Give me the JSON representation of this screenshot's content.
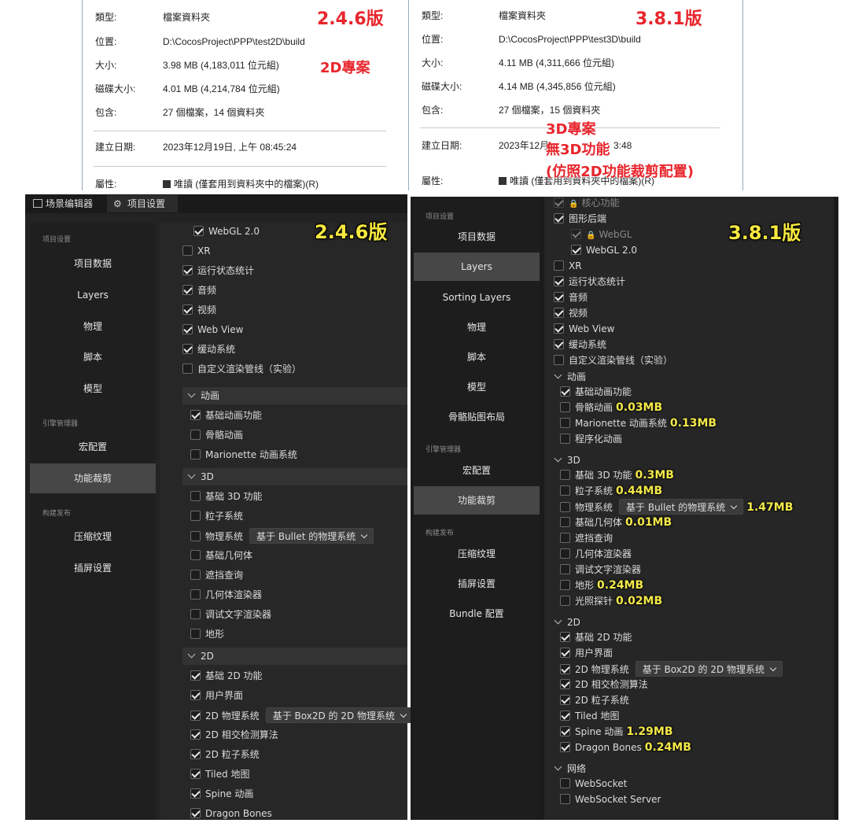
{
  "win_left": {
    "type_k": "類型:",
    "type_v": "檔案資料夾",
    "loc_k": "位置:",
    "loc_v": "D:\\CocosProject\\PPP\\test2D\\build",
    "size_k": "大小:",
    "size_v": "3.98 MB (4,183,011 位元組)",
    "disk_k": "磁碟大小:",
    "disk_v": "4.01 MB (4,214,784 位元組)",
    "contains_k": "包含:",
    "contains_v": "27 個檔案，14 個資料夾",
    "created_k": "建立日期:",
    "created_v": "2023年12月19日, 上午 08:45:24",
    "attr_k": "屬性:",
    "attr_v": "唯讀 (僅套用到資料夾中的檔案)(R)",
    "ver": "2.4.6版",
    "note": "2D專案"
  },
  "win_right": {
    "type_k": "類型:",
    "type_v": "檔案資料夾",
    "loc_k": "位置:",
    "loc_v": "D:\\CocosProject\\PPP\\test3D\\build",
    "size_k": "大小:",
    "size_v": "4.11 MB (4,311,666 位元組)",
    "disk_k": "磁碟大小:",
    "disk_v": "4.14 MB (4,345,856 位元組)",
    "contains_k": "包含:",
    "contains_v": "27 個檔案，15 個資料夾",
    "created_k": "建立日期:",
    "created_v_a": "2023年12月",
    "created_v_b": "3:48",
    "attr_k": "屬性:",
    "attr_v": "唯讀 (僅套用到資料夾中的檔案)(R)",
    "ver": "3.8.1版",
    "note1": "3D專案",
    "note2": "無3D功能",
    "note3": "(仿照2D功能裁剪配置)"
  },
  "left_panel": {
    "tab1": "场景编辑器",
    "tab2": "项目设置",
    "sec1": "项目设置",
    "sec2": "引擎管理器",
    "sec3": "构建发布",
    "nav": [
      "项目数据",
      "Layers",
      "物理",
      "脚本",
      "模型",
      "宏配置",
      "功能裁剪",
      "压缩纹理",
      "插屏设置"
    ],
    "ver": "2.4.6版",
    "items_top": [
      {
        "label": "WebGL 2.0",
        "on": true
      },
      {
        "label": "XR",
        "on": false
      },
      {
        "label": "运行状态统计",
        "on": true
      },
      {
        "label": "音频",
        "on": true
      },
      {
        "label": "视频",
        "on": true
      },
      {
        "label": "Web View",
        "on": true
      },
      {
        "label": "缓动系统",
        "on": true
      },
      {
        "label": "自定义渲染管线（实验）",
        "on": false
      }
    ],
    "grp_anim": "动画",
    "anim": [
      {
        "label": "基础动画功能",
        "on": true
      },
      {
        "label": "骨骼动画",
        "on": false
      },
      {
        "label": "Marionette 动画系统",
        "on": false
      }
    ],
    "grp_3d": "3D",
    "d3": [
      {
        "label": "基础 3D 功能",
        "on": false
      },
      {
        "label": "粒子系统",
        "on": false
      },
      {
        "label": "物理系统",
        "on": false
      },
      {
        "label": "基础几何体",
        "on": false
      },
      {
        "label": "遮挡查询",
        "on": false
      },
      {
        "label": "几何体渲染器",
        "on": false
      },
      {
        "label": "调试文字渲染器",
        "on": false
      },
      {
        "label": "地形",
        "on": false
      }
    ],
    "physics_sel": "基于 Bullet 的物理系统",
    "grp_2d": "2D",
    "d2": [
      {
        "label": "基础 2D 功能",
        "on": true
      },
      {
        "label": "用户界面",
        "on": true
      },
      {
        "label": "2D 物理系统",
        "on": true
      },
      {
        "label": "2D 相交检测算法",
        "on": true
      },
      {
        "label": "2D 粒子系统",
        "on": true
      },
      {
        "label": "Tiled 地图",
        "on": true
      },
      {
        "label": "Spine 动画",
        "on": true
      },
      {
        "label": "Dragon Bones",
        "on": true
      }
    ],
    "physics2d_sel": "基于 Box2D 的 2D 物理系统"
  },
  "right_panel": {
    "sec1": "项目设置",
    "sec2": "引擎管理器",
    "sec3": "构建发布",
    "nav": [
      "项目数据",
      "Layers",
      "Sorting Layers",
      "物理",
      "脚本",
      "模型",
      "骨骼贴图布局",
      "宏配置",
      "功能裁剪",
      "压缩纹理",
      "插屏设置",
      "Bundle 配置"
    ],
    "ver": "3.8.1版",
    "core": "核心功能",
    "gfx": "图形后端",
    "webgl": "WebGL",
    "webgl2": "WebGL 2.0",
    "items_top": [
      {
        "label": "XR",
        "on": false
      },
      {
        "label": "运行状态统计",
        "on": true
      },
      {
        "label": "音频",
        "on": true
      },
      {
        "label": "视频",
        "on": true
      },
      {
        "label": "Web View",
        "on": true
      },
      {
        "label": "缓动系统",
        "on": true
      },
      {
        "label": "自定义渲染管线（实验）",
        "on": false
      }
    ],
    "grp_anim": "动画",
    "anim": [
      {
        "label": "基础动画功能",
        "on": true,
        "size": ""
      },
      {
        "label": "骨骼动画",
        "on": false,
        "size": "0.03MB"
      },
      {
        "label": "Marionette 动画系统",
        "on": false,
        "size": "0.13MB"
      },
      {
        "label": "程序化动画",
        "on": false,
        "size": ""
      }
    ],
    "grp_3d": "3D",
    "d3": [
      {
        "label": "基础 3D 功能",
        "on": false,
        "size": "0.3MB"
      },
      {
        "label": "粒子系统",
        "on": false,
        "size": "0.44MB"
      },
      {
        "label": "物理系统",
        "on": false,
        "size": "1.47MB"
      },
      {
        "label": "基础几何体",
        "on": false,
        "size": "0.01MB"
      },
      {
        "label": "遮挡查询",
        "on": false,
        "size": ""
      },
      {
        "label": "几何体渲染器",
        "on": false,
        "size": ""
      },
      {
        "label": "调试文字渲染器",
        "on": false,
        "size": ""
      },
      {
        "label": "地形",
        "on": false,
        "size": "0.24MB"
      },
      {
        "label": "光照探针",
        "on": false,
        "size": "0.02MB"
      }
    ],
    "physics_sel": "基于 Bullet 的物理系统",
    "grp_2d": "2D",
    "d2": [
      {
        "label": "基础 2D 功能",
        "on": true,
        "size": ""
      },
      {
        "label": "用户界面",
        "on": true,
        "size": ""
      },
      {
        "label": "2D 物理系统",
        "on": true,
        "size": ""
      },
      {
        "label": "2D 相交检测算法",
        "on": true,
        "size": ""
      },
      {
        "label": "2D 粒子系统",
        "on": true,
        "size": ""
      },
      {
        "label": "Tiled 地图",
        "on": true,
        "size": ""
      },
      {
        "label": "Spine 动画",
        "on": true,
        "size": "1.29MB"
      },
      {
        "label": "Dragon Bones",
        "on": true,
        "size": "0.24MB"
      }
    ],
    "physics2d_sel": "基于 Box2D 的 2D 物理系统",
    "grp_net": "网络",
    "net": [
      {
        "label": "WebSocket",
        "on": false
      },
      {
        "label": "WebSocket Server",
        "on": false
      }
    ]
  }
}
